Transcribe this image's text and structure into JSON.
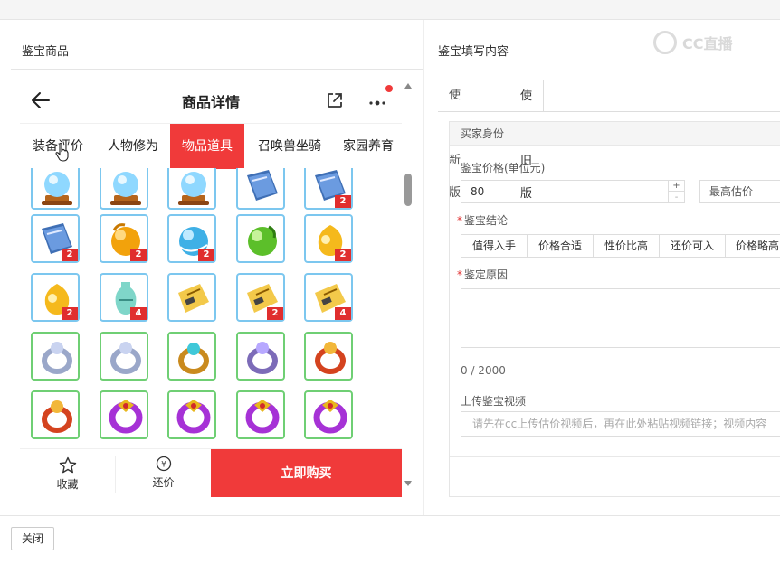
{
  "dialog": {
    "left_title": "鉴宝商品",
    "right_title": "鉴宝填写内容",
    "close_label": "关闭"
  },
  "phone": {
    "title": "商品详情",
    "tabs": [
      {
        "label": "装备评价",
        "active": false
      },
      {
        "label": "人物修为",
        "active": false
      },
      {
        "label": "物品道具",
        "active": true
      },
      {
        "label": "召唤兽坐骑",
        "active": false
      },
      {
        "label": "家园养育",
        "active": false
      }
    ],
    "bottom": {
      "favorite_label": "收藏",
      "bargain_label": "还价",
      "bargain_icon_glyph": "¥",
      "buy_label": "立即购买"
    },
    "items": [
      {
        "icon": "crystal-ball-icon",
        "border": "blue",
        "count": ""
      },
      {
        "icon": "crystal-ball-icon",
        "border": "blue",
        "count": ""
      },
      {
        "icon": "crystal-ball-icon",
        "border": "blue",
        "count": ""
      },
      {
        "icon": "book-icon",
        "border": "blue",
        "count": ""
      },
      {
        "icon": "book-icon",
        "border": "blue",
        "count": "2"
      },
      {
        "icon": "book-icon",
        "border": "blue",
        "count": "2"
      },
      {
        "icon": "orange-orb-icon",
        "border": "blue",
        "count": "2"
      },
      {
        "icon": "blue-orb-icon",
        "border": "blue",
        "count": "2"
      },
      {
        "icon": "green-orb-icon",
        "border": "blue",
        "count": ""
      },
      {
        "icon": "gold-orb-icon",
        "border": "blue",
        "count": "2"
      },
      {
        "icon": "gold-orb-icon",
        "border": "blue",
        "count": "2"
      },
      {
        "icon": "vase-icon",
        "border": "blue",
        "count": "4"
      },
      {
        "icon": "scroll-icon",
        "border": "blue",
        "count": ""
      },
      {
        "icon": "scroll-icon",
        "border": "blue",
        "count": "2"
      },
      {
        "icon": "scroll-icon",
        "border": "blue",
        "count": "4"
      },
      {
        "icon": "silver-ring-icon",
        "border": "green",
        "count": ""
      },
      {
        "icon": "silver-ring-icon",
        "border": "green",
        "count": ""
      },
      {
        "icon": "gem-ring-icon",
        "border": "green",
        "count": ""
      },
      {
        "icon": "purple-ring-icon",
        "border": "green",
        "count": ""
      },
      {
        "icon": "red-ring-icon",
        "border": "green",
        "count": ""
      },
      {
        "icon": "red-ring-icon",
        "border": "green",
        "count": ""
      },
      {
        "icon": "violet-ring-icon",
        "border": "green",
        "count": ""
      },
      {
        "icon": "violet-ring-icon",
        "border": "green",
        "count": ""
      },
      {
        "icon": "violet-ring-icon",
        "border": "green",
        "count": ""
      },
      {
        "icon": "violet-ring-icon",
        "border": "green",
        "count": ""
      }
    ]
  },
  "form": {
    "version_tabs": [
      {
        "label": "使用新版",
        "active": false
      },
      {
        "label": "使用旧版",
        "active": true
      }
    ],
    "section_title": "买家身份",
    "price_label": "鉴宝价格(单位元)",
    "price_value": "80",
    "spin_up": "+",
    "spin_down": "-",
    "price_type": "最高估价",
    "conclusion_label": "鉴宝结论",
    "conclusion_options": [
      "值得入手",
      "价格合适",
      "性价比高",
      "还价可入",
      "价格略高"
    ],
    "reason_label": "鉴定原因",
    "reason_counter": "0 / 2000",
    "video_label": "上传鉴宝视频",
    "video_placeholder": "请先在cc上传估价视频后，再在此处粘贴视频链接；视频内容"
  },
  "colors": {
    "accent_red": "#f03a3a",
    "badge_red": "#e02e2e",
    "blue_frame": "#7cc7ef",
    "green_frame": "#6fcf74"
  }
}
